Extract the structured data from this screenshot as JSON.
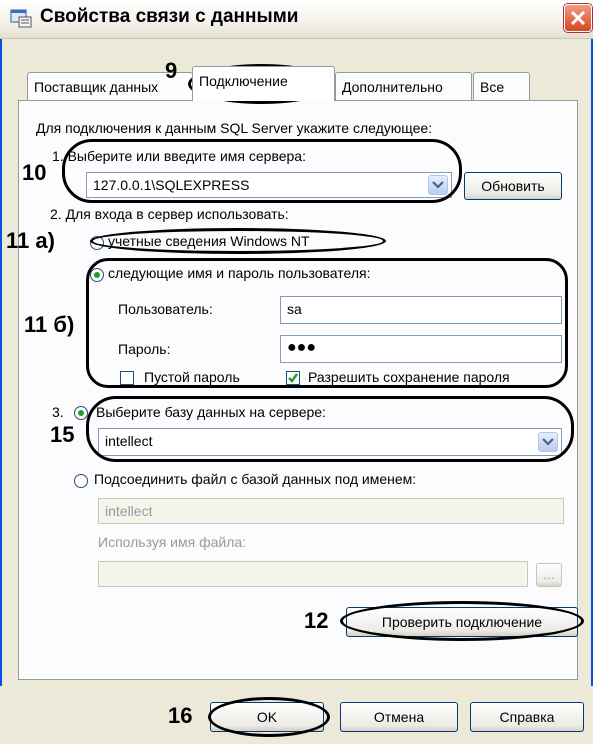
{
  "window": {
    "title": "Свойства связи с данными",
    "close_icon": "close-icon"
  },
  "tabs": [
    {
      "label": "Поставщик данных",
      "active": false
    },
    {
      "label": "Подключение",
      "active": true
    },
    {
      "label": "Дополнительно",
      "active": false
    },
    {
      "label": "Все",
      "active": false
    }
  ],
  "intro": "Для подключения к данным SQL Server укажите следующее:",
  "step1": {
    "label": "1. Выберите или введите имя сервера:",
    "server_value": "127.0.0.1\\SQLEXPRESS",
    "refresh_button": "Обновить"
  },
  "step2": {
    "label": "2. Для входа в сервер использовать:",
    "option_nt": {
      "label": "учетные сведения Windows NT",
      "selected": false
    },
    "option_user": {
      "label": "следующие имя и пароль пользователя:",
      "selected": true
    },
    "user_label": "Пользователь:",
    "user_value": "sa",
    "password_label": "Пароль:",
    "password_value": "●●●",
    "blank_password": {
      "label": "Пустой пароль",
      "checked": false
    },
    "allow_save": {
      "label": "Разрешить сохранение пароля",
      "checked": true
    }
  },
  "step3": {
    "prefix": "3.",
    "option_db": {
      "label": "Выберите базу данных на сервере:",
      "selected": true
    },
    "db_value": "intellect",
    "option_file": {
      "label": "Подсоединить файл с базой данных под именем:",
      "selected": false
    },
    "file_db_value": "intellect",
    "file_name_label": "Используя имя файла:",
    "file_name_value": "",
    "browse_button": "..."
  },
  "test_button": "Проверить подключение",
  "footer": {
    "ok": "OK",
    "cancel": "Отмена",
    "help": "Справка"
  },
  "annotations": {
    "n9": "9",
    "n10": "10",
    "n11a": "11 а)",
    "n11b": "11 б)",
    "n12": "12",
    "n15": "15",
    "n16": "16"
  }
}
